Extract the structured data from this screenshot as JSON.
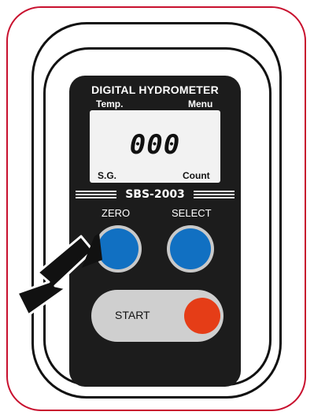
{
  "device": {
    "brand": "DIGITAL HYDROMETER",
    "model": "SBS-2003",
    "lcd": {
      "top_left": "Temp.",
      "top_right": "Menu",
      "reading": "000",
      "bottom_left": "S.G.",
      "bottom_right": "Count"
    },
    "buttons": {
      "zero_label": "ZERO",
      "select_label": "SELECT",
      "start_label": "START"
    }
  },
  "colors": {
    "frame": "#c8102e",
    "body": "#1c1c1c",
    "blue_button": "#1170c2",
    "start_button": "#e53d17"
  },
  "icons": {
    "pointer": "arrow-icon"
  }
}
